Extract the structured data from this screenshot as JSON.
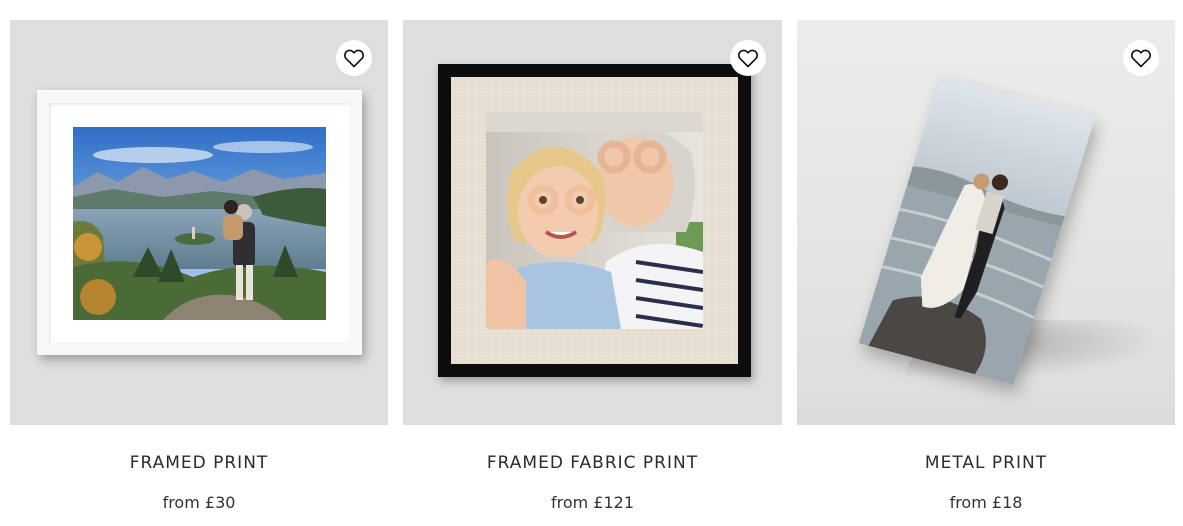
{
  "products": [
    {
      "title": "FRAMED PRINT",
      "price": "from £30",
      "favorite_icon": "heart-outline-icon"
    },
    {
      "title": "FRAMED FABRIC PRINT",
      "price": "from £121",
      "favorite_icon": "heart-outline-icon"
    },
    {
      "title": "METAL PRINT",
      "price": "from £18",
      "favorite_icon": "heart-outline-icon"
    }
  ],
  "colors": {
    "tile_background": "#dedede",
    "text": "#2b2b2b",
    "frame_white": "#f7f7f7",
    "frame_black": "#0d0d0d"
  }
}
